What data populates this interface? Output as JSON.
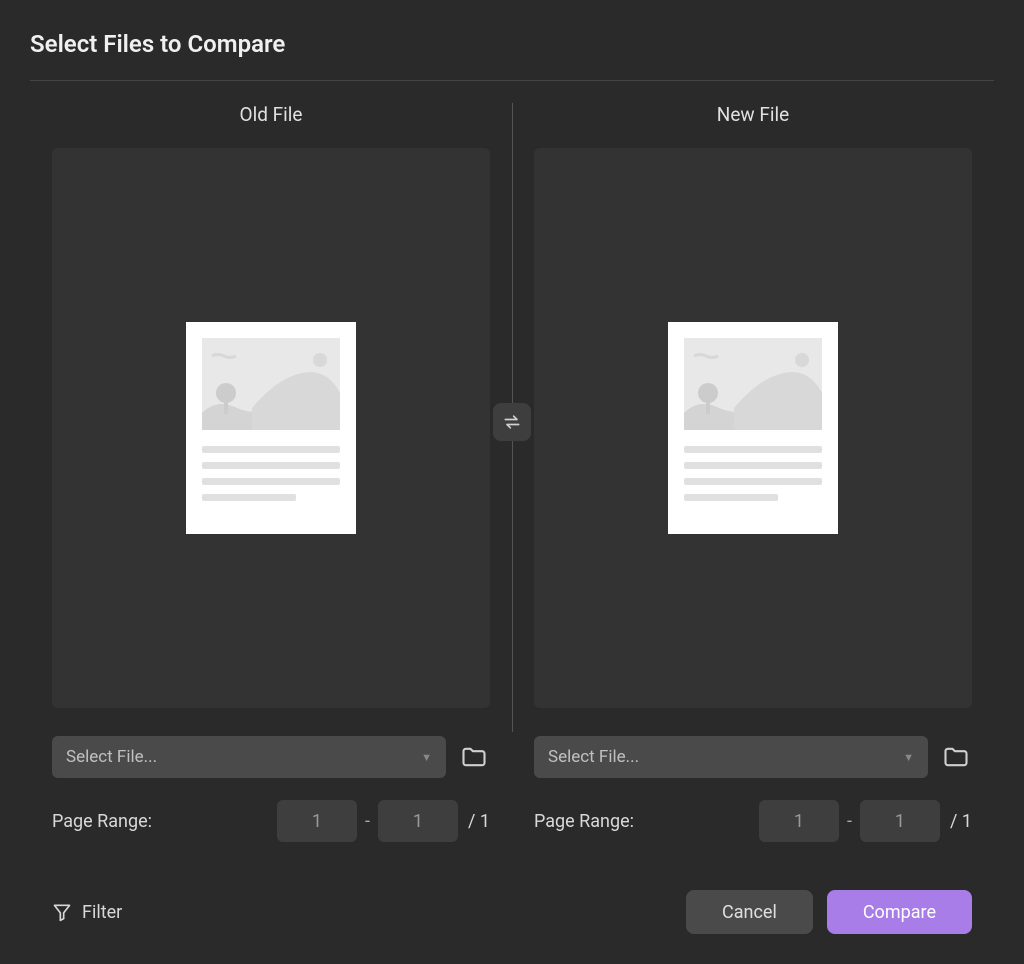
{
  "title": "Select Files to Compare",
  "old": {
    "title": "Old File",
    "select_placeholder": "Select File...",
    "page_range_label": "Page Range:",
    "page_from": "1",
    "page_to": "1",
    "page_total": "1"
  },
  "new": {
    "title": "New File",
    "select_placeholder": "Select File...",
    "page_range_label": "Page Range:",
    "page_from": "1",
    "page_to": "1",
    "page_total": "1"
  },
  "footer": {
    "filter_label": "Filter",
    "cancel_label": "Cancel",
    "compare_label": "Compare"
  },
  "range_dash": "-",
  "range_slash": "/ "
}
